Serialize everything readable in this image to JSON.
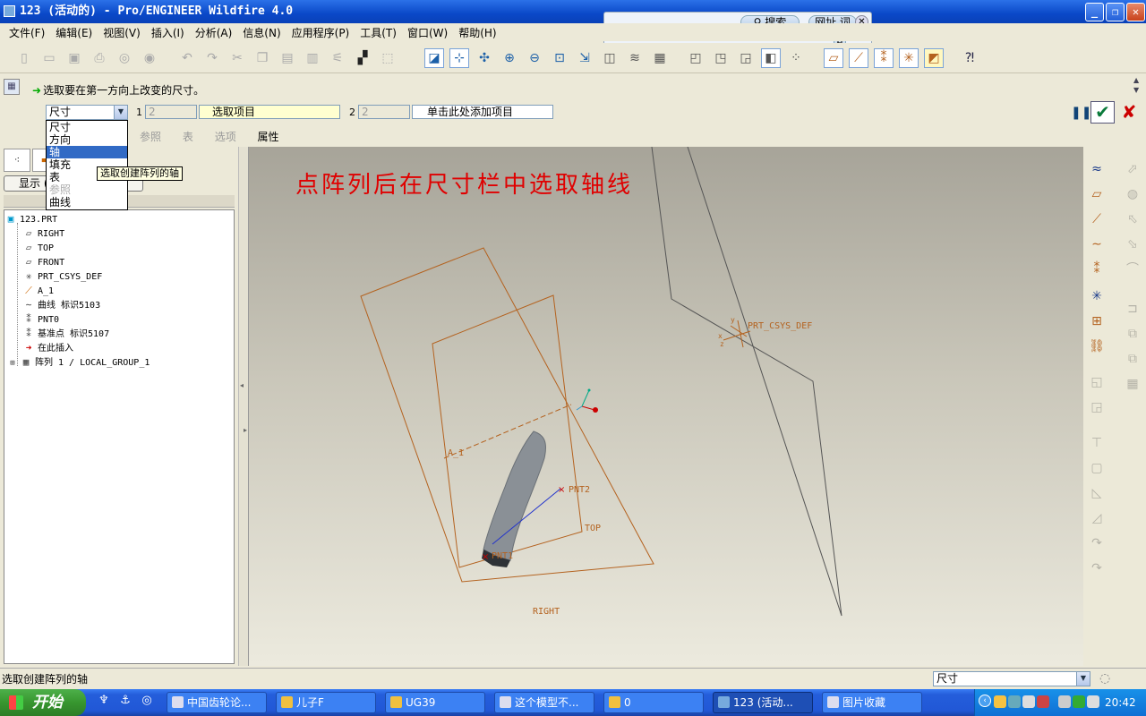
{
  "window": {
    "title": "123 (活动的) - Pro/ENGINEER Wildfire 4.0",
    "controls": [
      "_",
      "❐",
      "✕"
    ]
  },
  "menu": [
    "文件(F)",
    "编辑(E)",
    "视图(V)",
    "插入(I)",
    "分析(A)",
    "信息(N)",
    "应用程序(P)",
    "工具(T)",
    "窗口(W)",
    "帮助(H)"
  ],
  "search_overlay": {
    "search_label": "搜索",
    "url_label": "网址 词"
  },
  "dashboard": {
    "message": "选取要在第一方向上改变的尺寸。",
    "dir1_type": "尺寸",
    "dir1_index": "1",
    "dir1_count": "2",
    "dir1_collector": "选取项目",
    "dir2_index": "2",
    "dir2_count": "2",
    "dir2_collector": "单击此处添加项目",
    "tabs": [
      "参照",
      "表",
      "选项",
      "属性"
    ]
  },
  "type_dropdown": {
    "options": [
      "尺寸",
      "方向",
      "轴",
      "填充",
      "表",
      "参照",
      "曲线"
    ],
    "selected_index": 2,
    "disabled_index": 5,
    "tooltip": "选取创建阵列的轴"
  },
  "left_panel": {
    "show_button": "显示",
    "tree": [
      "123.PRT",
      "RIGHT",
      "TOP",
      "FRONT",
      "PRT_CSYS_DEF",
      "A_1",
      "曲线 标识5103",
      "PNT0",
      "基准点 标识5107",
      "在此插入",
      "阵列 1 / LOCAL_GROUP_1"
    ]
  },
  "viewport": {
    "annotation": "点阵列后在尺寸栏中选取轴线",
    "labels": {
      "csys": "PRT_CSYS_DEF",
      "axis": "A_1",
      "pnt2": "PNT2",
      "pnt1": "PNT1",
      "top": "TOP",
      "right": "RIGHT",
      "csys_x": "x",
      "csys_y": "y",
      "csys_z": "z"
    },
    "datum_color": "#b4621f"
  },
  "status_bar": {
    "message": "选取创建阵列的轴",
    "filter": "尺寸"
  },
  "taskbar": {
    "start": "开始",
    "tasks": [
      "中国齿轮论...",
      "儿子F",
      "UG39",
      "这个模型不...",
      "0",
      "123 (活动...",
      "图片收藏"
    ],
    "active_task_index": 5,
    "clock": "20:42"
  }
}
